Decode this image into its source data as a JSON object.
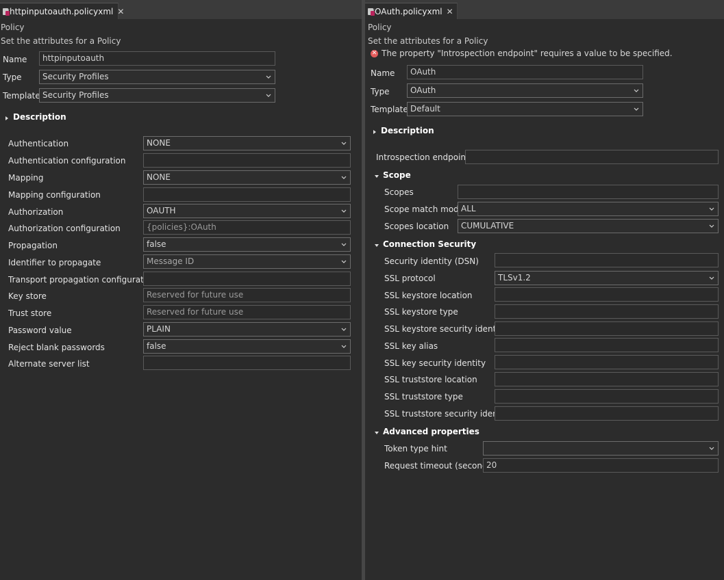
{
  "left": {
    "tab": {
      "label": "*httpinputoauth.policyxml",
      "close": "✕"
    },
    "heading": "Policy",
    "subheading": "Set the attributes for a Policy",
    "name": {
      "label": "Name",
      "value": "httpinputoauth"
    },
    "type": {
      "label": "Type",
      "value": "Security Profiles"
    },
    "template": {
      "label": "Template",
      "value": "Security Profiles"
    },
    "description_label": "Description",
    "props": [
      {
        "label": "Authentication",
        "value": "NONE",
        "kind": "combo"
      },
      {
        "label": "Authentication configuration",
        "value": "",
        "kind": "field"
      },
      {
        "label": "Mapping",
        "value": "NONE",
        "kind": "combo"
      },
      {
        "label": "Mapping configuration",
        "value": "",
        "kind": "field"
      },
      {
        "label": "Authorization",
        "value": "OAUTH",
        "kind": "combo"
      },
      {
        "label": "Authorization configuration",
        "value": "{policies}:OAuth",
        "kind": "field"
      },
      {
        "label": "Propagation",
        "value": "false",
        "kind": "combo"
      },
      {
        "label": "Identifier to propagate",
        "value": "Message ID",
        "kind": "combo"
      },
      {
        "label": "Transport propagation configuration",
        "value": "",
        "kind": "field"
      },
      {
        "label": "Key store",
        "value": "Reserved for future use",
        "kind": "field"
      },
      {
        "label": "Trust store",
        "value": "Reserved for future use",
        "kind": "field"
      },
      {
        "label": "Password value",
        "value": "PLAIN",
        "kind": "combo"
      },
      {
        "label": "Reject blank passwords",
        "value": "false",
        "kind": "combo"
      },
      {
        "label": "Alternate server list",
        "value": "",
        "kind": "field"
      }
    ]
  },
  "right": {
    "tab": {
      "label": "*OAuth.policyxml",
      "close": "✕"
    },
    "heading": "Policy",
    "subheading": "Set the attributes for a Policy",
    "error": "The property \"Introspection endpoint\" requires a value to be specified.",
    "name": {
      "label": "Name",
      "value": "OAuth"
    },
    "type": {
      "label": "Type",
      "value": "OAuth"
    },
    "template": {
      "label": "Template",
      "value": "Default"
    },
    "description_label": "Description",
    "introspection": {
      "label": "Introspection endpoint*",
      "value": ""
    },
    "scope": {
      "title": "Scope",
      "scopes": {
        "label": "Scopes",
        "value": ""
      },
      "match_mode": {
        "label": "Scope match mode",
        "value": "ALL"
      },
      "location": {
        "label": "Scopes location",
        "value": "CUMULATIVE"
      }
    },
    "connection": {
      "title": "Connection Security",
      "items": [
        {
          "label": "Security identity (DSN)",
          "value": "",
          "kind": "field"
        },
        {
          "label": "SSL protocol",
          "value": "TLSv1.2",
          "kind": "combo"
        },
        {
          "label": "SSL keystore location",
          "value": "",
          "kind": "field"
        },
        {
          "label": "SSL keystore type",
          "value": "",
          "kind": "field"
        },
        {
          "label": "SSL keystore security identity",
          "value": "",
          "kind": "field"
        },
        {
          "label": "SSL key alias",
          "value": "",
          "kind": "field"
        },
        {
          "label": "SSL key security identity",
          "value": "",
          "kind": "field"
        },
        {
          "label": "SSL truststore location",
          "value": "",
          "kind": "field"
        },
        {
          "label": "SSL truststore type",
          "value": "",
          "kind": "field"
        },
        {
          "label": "SSL truststore security identity",
          "value": "",
          "kind": "field"
        }
      ]
    },
    "advanced": {
      "title": "Advanced properties",
      "token_hint": {
        "label": "Token type hint",
        "value": ""
      },
      "timeout": {
        "label": "Request timeout (seconds)",
        "value": "20"
      }
    }
  }
}
